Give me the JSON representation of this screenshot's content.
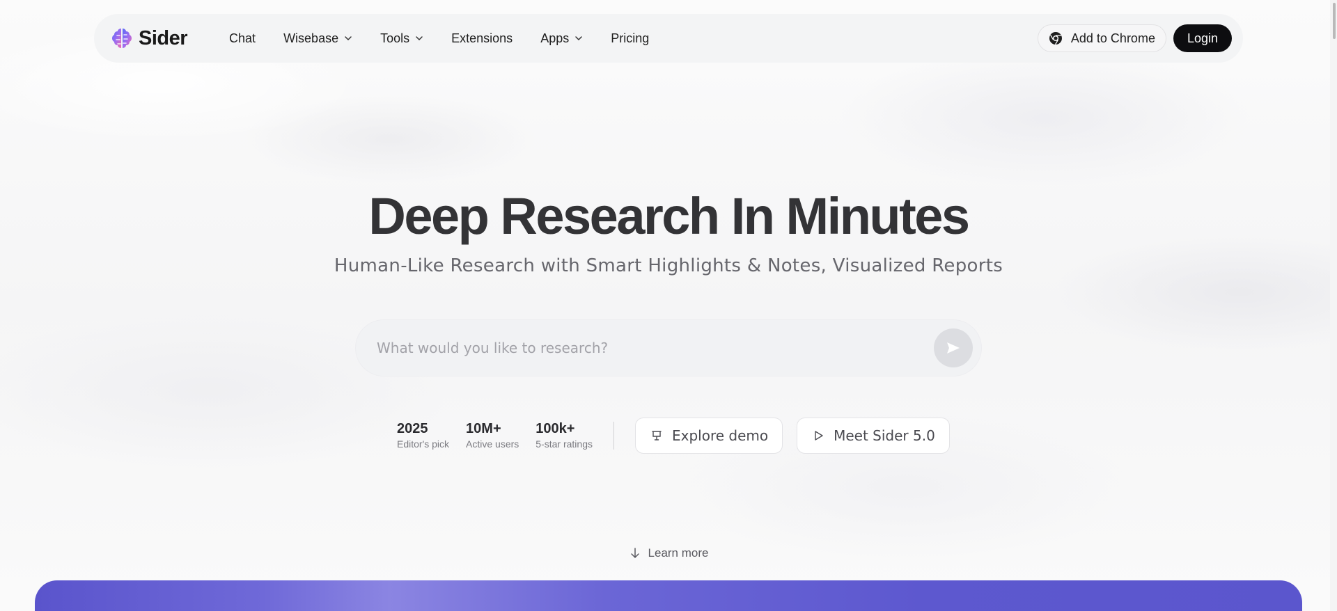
{
  "brand": {
    "name": "Sider"
  },
  "nav": {
    "items": [
      {
        "label": "Chat",
        "dropdown": false
      },
      {
        "label": "Wisebase",
        "dropdown": true
      },
      {
        "label": "Tools",
        "dropdown": true
      },
      {
        "label": "Extensions",
        "dropdown": false
      },
      {
        "label": "Apps",
        "dropdown": true
      },
      {
        "label": "Pricing",
        "dropdown": false
      }
    ],
    "add_to_chrome": "Add to Chrome",
    "login": "Login"
  },
  "hero": {
    "title": "Deep Research In Minutes",
    "subtitle": "Human-Like Research with Smart Highlights & Notes, Visualized Reports"
  },
  "search": {
    "placeholder": "What would you like to research?",
    "value": ""
  },
  "stats": [
    {
      "value": "2025",
      "label": "Editor's pick"
    },
    {
      "value": "10M+",
      "label": "Active users"
    },
    {
      "value": "100k+",
      "label": "5-star ratings"
    }
  ],
  "actions": {
    "explore_demo": "Explore demo",
    "meet_sider": "Meet Sider 5.0"
  },
  "learn_more": "Learn more",
  "colors": {
    "login_bg": "#0d0d10",
    "banner": "#5a54cc",
    "logo_gradient_start": "#5b6cf5",
    "logo_gradient_end": "#f26ab0"
  },
  "icons": {
    "logo": "brain-icon",
    "chrome": "chrome-icon",
    "send": "send-icon",
    "demo": "presentation-icon",
    "play": "play-icon",
    "learn_more": "arrow-down-icon"
  }
}
